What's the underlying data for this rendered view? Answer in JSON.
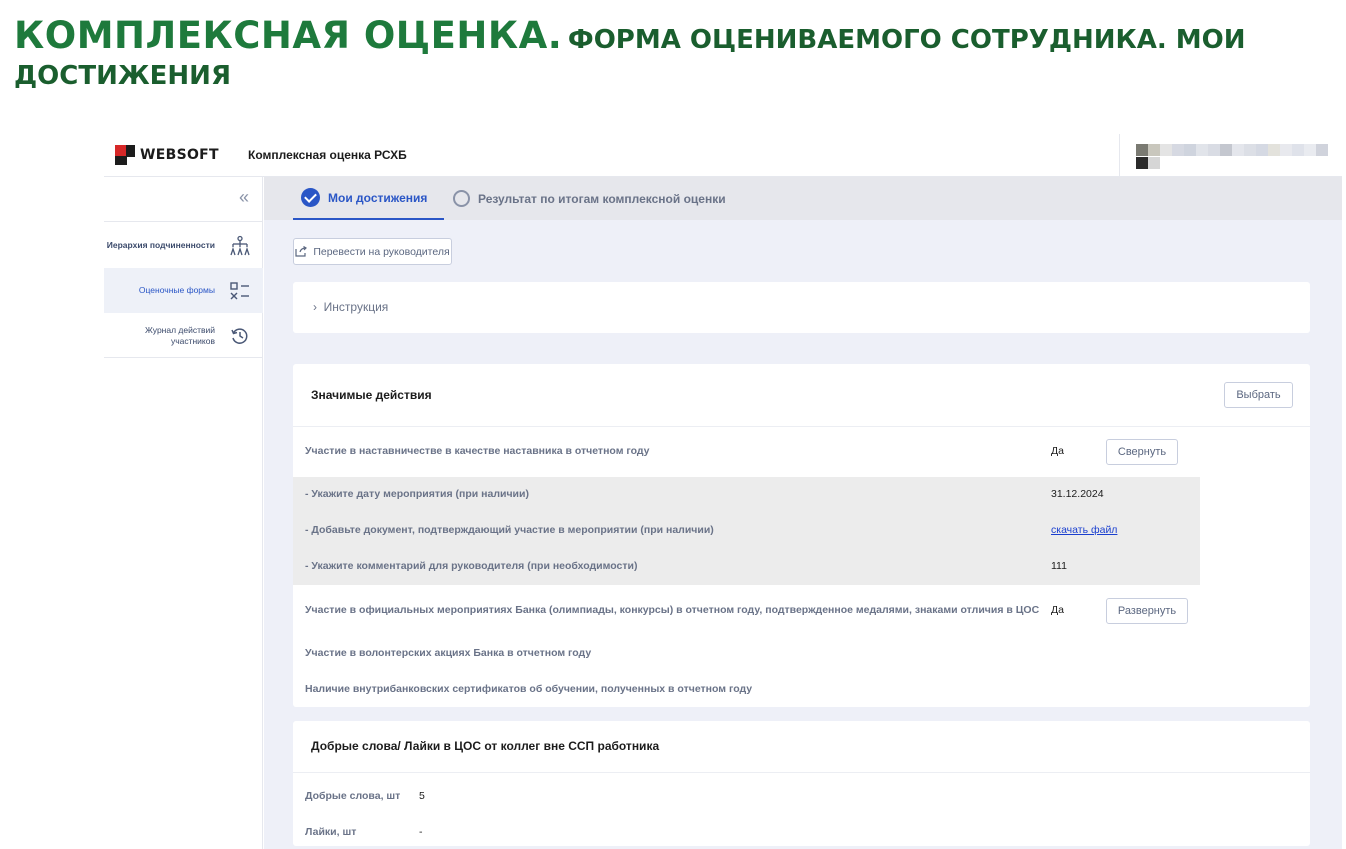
{
  "slide": {
    "title_main": "Комплексная оценка",
    "title_dot": ".",
    "title_rest": "Форма оцениваемого сотрудника. Мои",
    "title_line2": "достижения"
  },
  "header": {
    "logo_text": "WEBSOFT",
    "app_name": "Комплексная оценка РСХБ"
  },
  "sidebar": {
    "collapse_icon": "double-chevron-left-icon",
    "items": [
      {
        "label": "Иерархия подчиненности",
        "icon": "hierarchy-icon"
      },
      {
        "label": "Оценочные формы",
        "icon": "checklist-icon"
      },
      {
        "label": "Журнал действий участников",
        "icon": "history-icon"
      }
    ]
  },
  "tabs": [
    {
      "label": "Мои достижения",
      "state": "completed"
    },
    {
      "label": "Результат по итогам комплексной оценки",
      "state": "pending"
    }
  ],
  "toolbar": {
    "transfer_label": "Перевести на руководителя"
  },
  "instruction": {
    "label": "Инструкция"
  },
  "actions_card": {
    "title": "Значимые действия",
    "choose_label": "Выбрать",
    "rows": [
      {
        "q": "Участие в наставничестве в качестве наставника в отчетном году",
        "a": "Да",
        "btn": "Свернуть"
      },
      {
        "q": "- Укажите дату мероприятия (при наличии)",
        "a": "31.12.2024"
      },
      {
        "q": "- Добавьте документ, подтверждающий участие в мероприятии (при наличии)",
        "a": "скачать файл"
      },
      {
        "q": "- Укажите комментарий для руководителя (при необходимости)",
        "a": "111"
      },
      {
        "q": "Участие в официальных мероприятиях Банка (олимпиады, конкурсы) в отчетном году, подтвержденное медалями, знаками отличия в ЦОС",
        "a": "Да",
        "btn": "Развернуть"
      },
      {
        "q": "Участие в волонтерских акциях Банка в отчетном году"
      },
      {
        "q": "Наличие внутрибанковских сертификатов об обучении, полученных в отчетном году"
      }
    ]
  },
  "words_card": {
    "title": "Добрые слова/ Лайки в ЦОС от коллег вне ССП работника",
    "rows": [
      {
        "k": "Добрые слова, шт",
        "v": "5"
      },
      {
        "k": "Лайки, шт",
        "v": "-"
      }
    ]
  },
  "colors": {
    "accent": "#2a56c6",
    "slide_green": "#1e7a3c",
    "link": "#1a3fcf"
  }
}
